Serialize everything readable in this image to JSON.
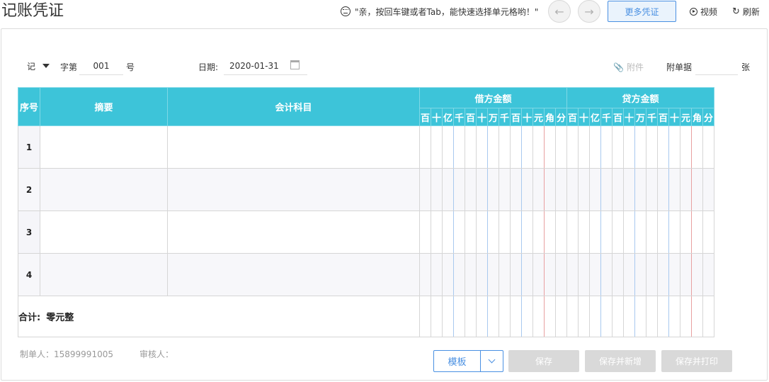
{
  "header": {
    "title": "记账凭证",
    "tip": "\"亲，按回车键或者Tab，能快速选择单元格哟！\"",
    "prev_icon": "arrow-left-icon",
    "next_icon": "arrow-right-icon",
    "more_label": "更多凭证",
    "video_label": "视频",
    "refresh_label": "刷新",
    "accent_color": "#4a90e2"
  },
  "form": {
    "voucher_type": "记",
    "zi_di_label": "字第",
    "voucher_no": "001",
    "hao_label": "号",
    "date_label": "日期:",
    "date_value": "2020-01-31",
    "attach_label": "附件",
    "attach_docs_label": "附单据",
    "attach_count": "",
    "zhang_label": "张"
  },
  "table": {
    "header_color": "#3dc4d9",
    "seq_header": "序号",
    "summary_header": "摘要",
    "account_header": "会计科目",
    "debit_header": "借方金额",
    "credit_header": "贷方金额",
    "digits": [
      "百",
      "十",
      "亿",
      "千",
      "百",
      "十",
      "万",
      "千",
      "百",
      "十",
      "元",
      "角",
      "分"
    ],
    "rows": [
      {
        "seq": "1",
        "summary": "",
        "account": ""
      },
      {
        "seq": "2",
        "summary": "",
        "account": ""
      },
      {
        "seq": "3",
        "summary": "",
        "account": ""
      },
      {
        "seq": "4",
        "summary": "",
        "account": ""
      }
    ],
    "total_label": "合计:",
    "total_value": "零元整"
  },
  "footer": {
    "preparer": "制单人：15899991005",
    "auditor": "审核人：",
    "template_label": "模板",
    "save_label": "保存",
    "save_new_label": "保存并新增",
    "save_print_label": "保存并打印"
  }
}
